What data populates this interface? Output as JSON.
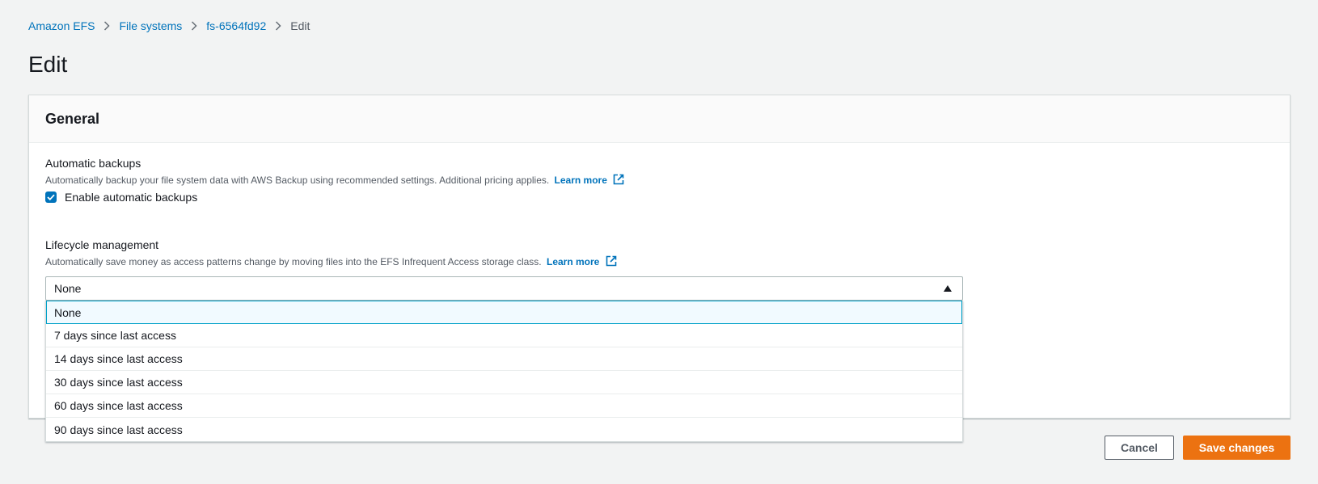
{
  "breadcrumb": {
    "items": [
      "Amazon EFS",
      "File systems",
      "fs-6564fd92"
    ],
    "current": "Edit"
  },
  "page": {
    "title": "Edit"
  },
  "panel": {
    "title": "General"
  },
  "backups": {
    "label": "Automatic backups",
    "description": "Automatically backup your file system data with AWS Backup using recommended settings. Additional pricing applies.",
    "learn_more": "Learn more",
    "checkbox_label": "Enable automatic backups",
    "checked": true
  },
  "lifecycle": {
    "label": "Lifecycle management",
    "description": "Automatically save money as access patterns change by moving files into the EFS Infrequent Access storage class.",
    "learn_more": "Learn more",
    "selected": "None",
    "options": [
      "None",
      "7 days since last access",
      "14 days since last access",
      "30 days since last access",
      "60 days since last access",
      "90 days since last access"
    ]
  },
  "actions": {
    "cancel": "Cancel",
    "save": "Save changes"
  },
  "colors": {
    "link": "#0073bb",
    "primary_button": "#ec7211",
    "highlight_border": "#00a1c9"
  }
}
